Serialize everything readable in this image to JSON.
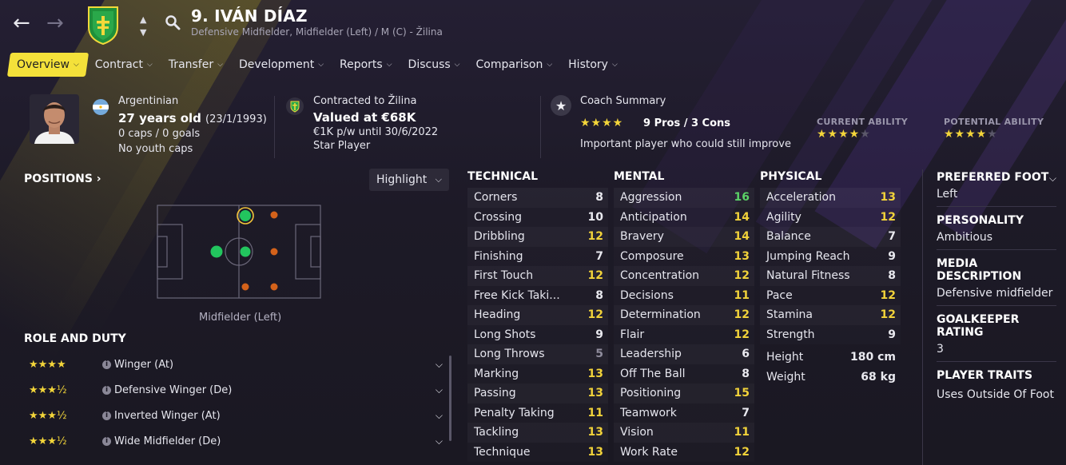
{
  "header": {
    "back_icon": "arrow-left-icon",
    "forward_icon": "arrow-right-icon",
    "club_badge_icon": "club-badge-icon",
    "search_icon": "search-icon",
    "player_title": "9. IVÁN DÍAZ",
    "player_subtitle": "Defensive Midfielder, Midfielder (Left) / M (C) - Žilina"
  },
  "nav": {
    "tabs": [
      {
        "label": "Overview",
        "active": true
      },
      {
        "label": "Contract"
      },
      {
        "label": "Transfer"
      },
      {
        "label": "Development"
      },
      {
        "label": "Reports"
      },
      {
        "label": "Discuss"
      },
      {
        "label": "Comparison"
      },
      {
        "label": "History"
      }
    ]
  },
  "info": {
    "nationality": "Argentinian",
    "age": "27 years old",
    "dob": "(23/1/1993)",
    "caps": "0 caps / 0 goals",
    "youth_caps": "No youth caps",
    "contract_club": "Contracted to Žilina",
    "value": "Valued at €68K",
    "wage": "€1K p/w until 30/6/2022",
    "status": "Star Player",
    "coach_title": "Coach Summary",
    "coach_pros_cons": "9 Pros / 3 Cons",
    "coach_stars": 4,
    "coach_note": "Important player who could still improve",
    "current_ability_label": "CURRENT ABILITY",
    "current_ability_stars": 4,
    "potential_ability_label": "POTENTIAL ABILITY",
    "potential_ability_stars": 4
  },
  "positions": {
    "title": "POSITIONS",
    "highlight_label": "Highlight",
    "pitch_caption": "Midfielder (Left)"
  },
  "roles": {
    "title": "ROLE AND DUTY",
    "items": [
      {
        "stars": "★★★★",
        "label": "Winger (At)"
      },
      {
        "stars": "★★★½",
        "label": "Defensive Winger (De)"
      },
      {
        "stars": "★★★½",
        "label": "Inverted Winger (At)"
      },
      {
        "stars": "★★★½",
        "label": "Wide Midfielder (De)"
      }
    ]
  },
  "attributes": {
    "technical": {
      "title": "TECHNICAL",
      "rows": [
        {
          "name": "Corners",
          "value": "8",
          "color": "white"
        },
        {
          "name": "Crossing",
          "value": "10",
          "color": "white"
        },
        {
          "name": "Dribbling",
          "value": "12",
          "color": "yellow"
        },
        {
          "name": "Finishing",
          "value": "7",
          "color": "white"
        },
        {
          "name": "First Touch",
          "value": "12",
          "color": "yellow"
        },
        {
          "name": "Free Kick Taki...",
          "value": "8",
          "color": "white"
        },
        {
          "name": "Heading",
          "value": "12",
          "color": "yellow"
        },
        {
          "name": "Long Shots",
          "value": "9",
          "color": "white"
        },
        {
          "name": "Long Throws",
          "value": "5",
          "color": "grey"
        },
        {
          "name": "Marking",
          "value": "13",
          "color": "yellow"
        },
        {
          "name": "Passing",
          "value": "13",
          "color": "yellow"
        },
        {
          "name": "Penalty Taking",
          "value": "11",
          "color": "yellow"
        },
        {
          "name": "Tackling",
          "value": "13",
          "color": "yellow"
        },
        {
          "name": "Technique",
          "value": "13",
          "color": "yellow"
        }
      ]
    },
    "mental": {
      "title": "MENTAL",
      "rows": [
        {
          "name": "Aggression",
          "value": "16",
          "color": "green"
        },
        {
          "name": "Anticipation",
          "value": "14",
          "color": "yellow"
        },
        {
          "name": "Bravery",
          "value": "14",
          "color": "yellow"
        },
        {
          "name": "Composure",
          "value": "13",
          "color": "yellow"
        },
        {
          "name": "Concentration",
          "value": "12",
          "color": "yellow"
        },
        {
          "name": "Decisions",
          "value": "11",
          "color": "yellow"
        },
        {
          "name": "Determination",
          "value": "12",
          "color": "yellow"
        },
        {
          "name": "Flair",
          "value": "12",
          "color": "yellow"
        },
        {
          "name": "Leadership",
          "value": "6",
          "color": "white"
        },
        {
          "name": "Off The Ball",
          "value": "8",
          "color": "white"
        },
        {
          "name": "Positioning",
          "value": "15",
          "color": "yellow"
        },
        {
          "name": "Teamwork",
          "value": "7",
          "color": "white"
        },
        {
          "name": "Vision",
          "value": "11",
          "color": "yellow"
        },
        {
          "name": "Work Rate",
          "value": "12",
          "color": "yellow"
        }
      ]
    },
    "physical": {
      "title": "PHYSICAL",
      "rows": [
        {
          "name": "Acceleration",
          "value": "13",
          "color": "yellow"
        },
        {
          "name": "Agility",
          "value": "12",
          "color": "yellow"
        },
        {
          "name": "Balance",
          "value": "7",
          "color": "white"
        },
        {
          "name": "Jumping Reach",
          "value": "9",
          "color": "white"
        },
        {
          "name": "Natural Fitness",
          "value": "8",
          "color": "white"
        },
        {
          "name": "Pace",
          "value": "12",
          "color": "yellow"
        },
        {
          "name": "Stamina",
          "value": "12",
          "color": "yellow"
        },
        {
          "name": "Strength",
          "value": "9",
          "color": "white"
        }
      ],
      "height_label": "Height",
      "height_value": "180 cm",
      "weight_label": "Weight",
      "weight_value": "68 kg"
    }
  },
  "right_panel": {
    "preferred_foot_title": "PREFERRED FOOT",
    "preferred_foot_value": "Left",
    "personality_title": "PERSONALITY",
    "personality_value": "Ambitious",
    "media_title": "MEDIA DESCRIPTION",
    "media_value": "Defensive midfielder",
    "gk_title": "GOALKEEPER RATING",
    "gk_value": "3",
    "traits_title": "PLAYER TRAITS",
    "traits_value": "Uses Outside Of Foot"
  },
  "colors": {
    "accent_yellow": "#f4e13a",
    "attr_yellow": "#f1d23a",
    "attr_green": "#5bd267",
    "position_green": "#22c55e",
    "position_orange": "#d4621a"
  }
}
